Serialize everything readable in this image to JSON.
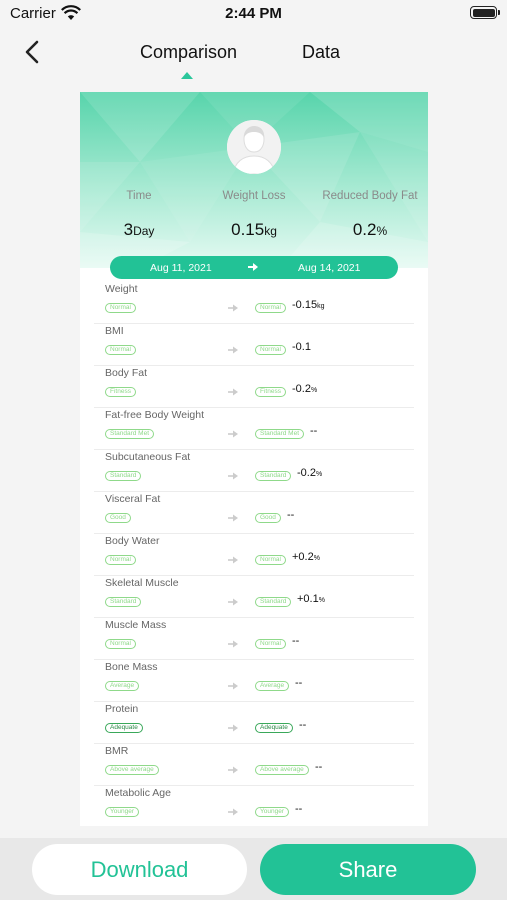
{
  "status": {
    "carrier": "Carrier",
    "time": "2:44 PM"
  },
  "nav": {
    "tab_comparison": "Comparison",
    "tab_data": "Data"
  },
  "summary": {
    "time_label": "Time",
    "time_value": "3",
    "time_unit": "Day",
    "weight_loss_label": "Weight Loss",
    "weight_loss_value": "0.15",
    "weight_loss_unit": "kg",
    "reduced_fat_label": "Reduced Body Fat",
    "reduced_fat_value": "0.2",
    "reduced_fat_unit": "%"
  },
  "dates": {
    "start": "Aug 11, 2021",
    "end": "Aug 14, 2021"
  },
  "metrics": [
    {
      "name": "Weight",
      "from": "Normal",
      "to": "Normal",
      "delta": "-0.15",
      "unit": "kg",
      "dark": false
    },
    {
      "name": "BMI",
      "from": "Normal",
      "to": "Normal",
      "delta": "-0.1",
      "unit": "",
      "dark": false
    },
    {
      "name": "Body Fat",
      "from": "Fitness",
      "to": "Fitness",
      "delta": "-0.2",
      "unit": "%",
      "dark": false
    },
    {
      "name": "Fat-free Body Weight",
      "from": "Standard Met",
      "to": "Standard Met",
      "delta": "--",
      "unit": "",
      "dark": false
    },
    {
      "name": "Subcutaneous Fat",
      "from": "Standard",
      "to": "Standard",
      "delta": "-0.2",
      "unit": "%",
      "dark": false
    },
    {
      "name": "Visceral Fat",
      "from": "Good",
      "to": "Good",
      "delta": "--",
      "unit": "",
      "dark": false
    },
    {
      "name": "Body Water",
      "from": "Normal",
      "to": "Normal",
      "delta": "+0.2",
      "unit": "%",
      "dark": false
    },
    {
      "name": "Skeletal Muscle",
      "from": "Standard",
      "to": "Standard",
      "delta": "+0.1",
      "unit": "%",
      "dark": false
    },
    {
      "name": "Muscle Mass",
      "from": "Normal",
      "to": "Normal",
      "delta": "--",
      "unit": "",
      "dark": false
    },
    {
      "name": "Bone Mass",
      "from": "Average",
      "to": "Average",
      "delta": "--",
      "unit": "",
      "dark": false
    },
    {
      "name": "Protein",
      "from": "Adequate",
      "to": "Adequate",
      "delta": "--",
      "unit": "",
      "dark": true
    },
    {
      "name": "BMR",
      "from": "Above average",
      "to": "Above average",
      "delta": "--",
      "unit": "",
      "dark": false
    },
    {
      "name": "Metabolic Age",
      "from": "Younger",
      "to": "Younger",
      "delta": "--",
      "unit": "",
      "dark": false
    }
  ],
  "actions": {
    "download": "Download",
    "share": "Share"
  },
  "colors": {
    "accent": "#22c296",
    "badge": "#8fd98a"
  }
}
